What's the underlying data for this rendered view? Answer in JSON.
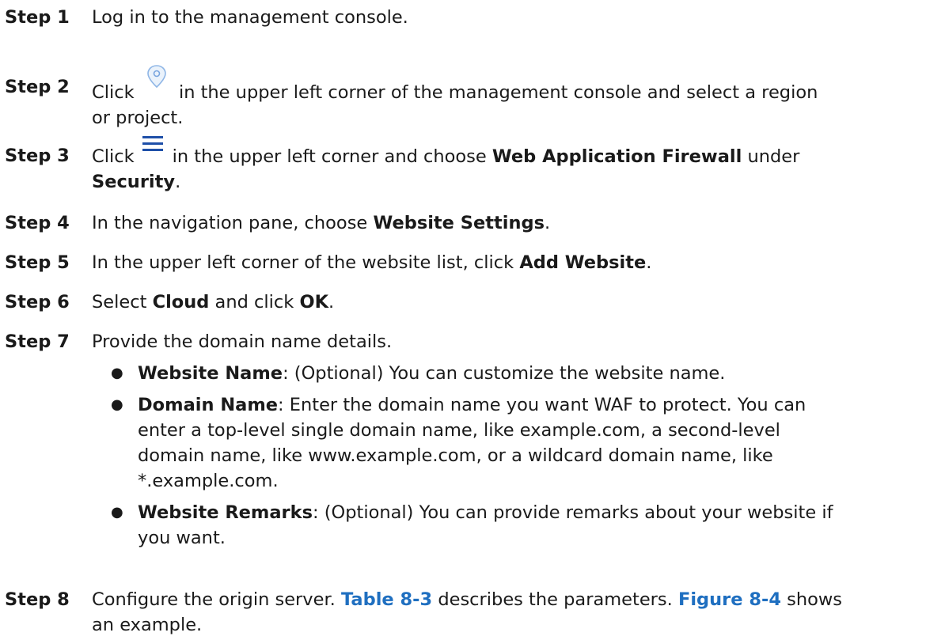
{
  "steps": [
    {
      "label": "Step 1",
      "text": "Log in to the management console."
    },
    {
      "label": "Step 2",
      "pre": "Click",
      "post1": "in the upper left corner of the management console and select a region",
      "post2": "or project.",
      "icon": "location-pin-icon"
    },
    {
      "label": "Step 3",
      "pre": "Click",
      "post": "in the upper left corner and choose",
      "b1": "Web Application Firewall",
      "mid": "under",
      "b2": "Security",
      "end": ".",
      "icon": "hamburger-menu-icon"
    },
    {
      "label": "Step 4",
      "pre": "In the navigation pane, choose",
      "b1": "Website Settings",
      "end": "."
    },
    {
      "label": "Step 5",
      "pre": "In the upper left corner of the website list, click",
      "b1": "Add Website",
      "end": "."
    },
    {
      "label": "Step 6",
      "pre": "Select",
      "b1": "Cloud",
      "mid": "and click",
      "b2": "OK",
      "end": "."
    },
    {
      "label": "Step 7",
      "text": "Provide the domain name details."
    },
    {
      "label": "Step 8",
      "pre": "Configure the origin server.",
      "link1": "Table 8-3",
      "mid": "describes the parameters.",
      "link2": "Figure 8-4",
      "post": "shows",
      "line2": "an example."
    }
  ],
  "bullets": [
    {
      "term": "Website Name",
      "lines": [
        ": (Optional) You can customize the website name."
      ]
    },
    {
      "term": "Domain Name",
      "lines": [
        ": Enter the domain name you want WAF to protect. You can",
        "enter a top-level single domain name, like example.com, a second-level",
        "domain name, like www.example.com, or a wildcard domain name, like",
        "*.example.com."
      ]
    },
    {
      "term": "Website Remarks",
      "lines": [
        ": (Optional) You can provide remarks about your website if",
        "you want."
      ]
    }
  ]
}
